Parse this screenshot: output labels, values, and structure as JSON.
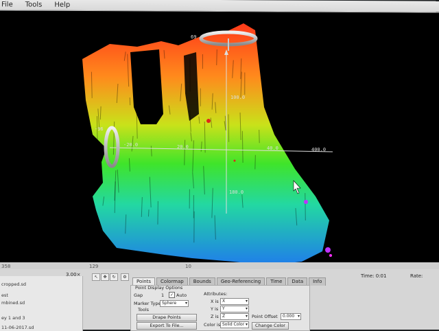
{
  "menu": {
    "items": [
      "File",
      "Tools",
      "Help"
    ]
  },
  "viewport": {
    "axis_labels": {
      "x_neg": "-20.0",
      "x_mid": "20.0",
      "x_pos": "40.0",
      "x_end": "400.0",
      "y_top": "100.0",
      "y_bottom": "180.0",
      "top_label": "69",
      "left_label": "-96"
    }
  },
  "status": {
    "left": "358",
    "mid1": "129",
    "mid2": "10"
  },
  "bottom": {
    "files": [
      "cropped.sd",
      "est",
      "mbined.sd",
      "ey 1 and 3",
      "11-06-2017.sd"
    ],
    "speed": "3.00×",
    "tabs": [
      "Points",
      "Colormap",
      "Bounds",
      "Geo-Referencing",
      "Time",
      "Data",
      "Info"
    ],
    "active_tab": "Points",
    "panel": {
      "section": "Point Display Options",
      "gap_label": "Gap",
      "gap_value": "1",
      "auto_label": "Auto",
      "marker_label": "Marker Type",
      "marker_value": "Sphere",
      "tools_label": "Tools",
      "drape_button": "Drape Points",
      "export_button": "Export To File...",
      "attributes_label": "Attributes:",
      "x_label": "X is",
      "x_value": "X",
      "y_label": "Y is",
      "y_value": "Y",
      "z_label": "Z is",
      "z_value": "Z",
      "color_label": "Color is",
      "color_value": "Solid Color",
      "point_offset_label": "Point Offset",
      "point_offset_value": "0.000",
      "change_color_button": "Change Color"
    },
    "time_label": "Time:",
    "time_value": "0:01",
    "rate_label": "Rate:"
  }
}
